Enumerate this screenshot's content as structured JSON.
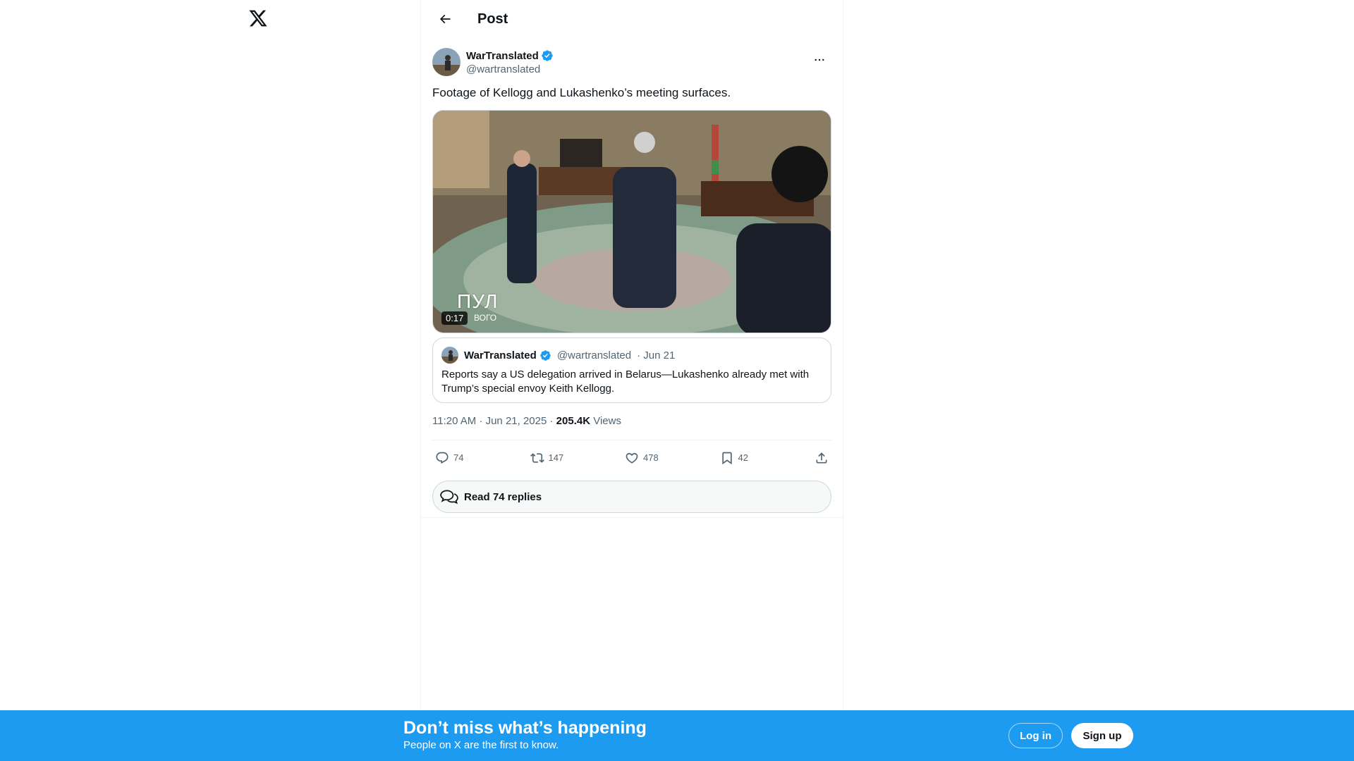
{
  "logo": {
    "icon": "x-logo-icon"
  },
  "header": {
    "title": "Post",
    "back_icon": "arrow-left-icon"
  },
  "post": {
    "author_name": "WarTranslated",
    "author_handle": "@wartranslated",
    "verified": true,
    "text": "Footage of Kellogg and Lukashenko’s meeting surfaces.",
    "media": {
      "duration": "0:17",
      "overlay_text": "ПУЛ",
      "overlay_sub": "ВОГО"
    },
    "quote": {
      "author_name": "WarTranslated",
      "author_handle": "@wartranslated",
      "date": "· Jun 21",
      "text": "Reports say a US delegation arrived in Belarus—Lukashenko already met with Trump’s special envoy Keith Kellogg."
    },
    "meta": {
      "time_date": "11:20 AM · Jun 21, 2025 · ",
      "views_count": "205.4K",
      "views_label": " Views"
    },
    "actions": {
      "replies": "74",
      "reposts": "147",
      "likes": "478",
      "bookmarks": "42"
    },
    "read_replies": "Read 74 replies"
  },
  "banner": {
    "title": "Don’t miss what’s happening",
    "subtitle": "People on X are the first to know.",
    "login": "Log in",
    "signup": "Sign up"
  },
  "colors": {
    "accent": "#1d9bf0",
    "text": "#0f1419",
    "secondary": "#536471",
    "border": "#cfd9de"
  }
}
